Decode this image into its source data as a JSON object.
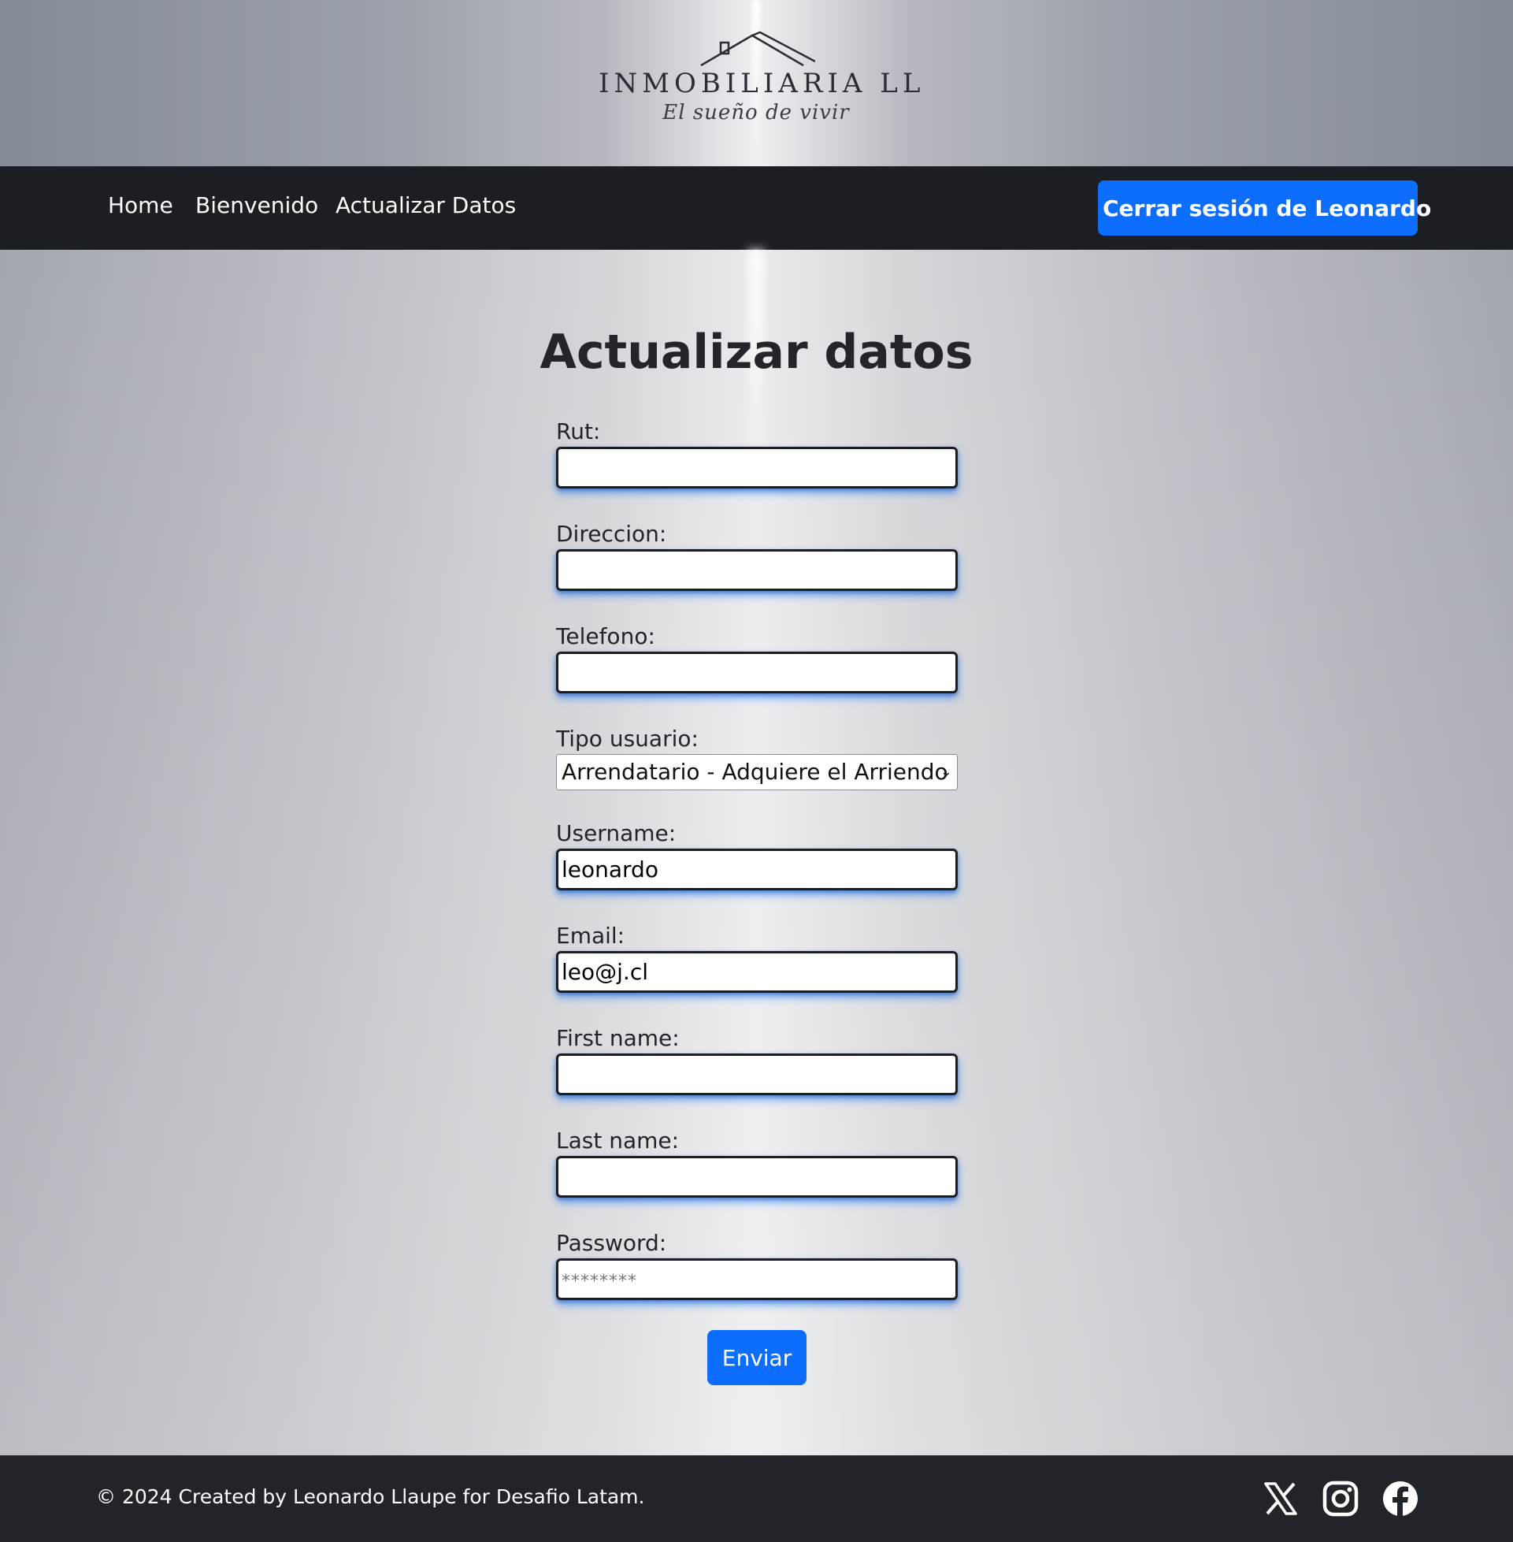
{
  "brand": {
    "name": "INMOBILIARIA LL",
    "tagline": "El sueño de vivir"
  },
  "nav": {
    "links": [
      "Home",
      "Bienvenido",
      "Actualizar Datos"
    ],
    "logout_label": "Cerrar sesión de Leonardo"
  },
  "page": {
    "title": "Actualizar datos"
  },
  "form": {
    "rut": {
      "label": "Rut:",
      "value": ""
    },
    "direccion": {
      "label": "Direccion:",
      "value": ""
    },
    "telefono": {
      "label": "Telefono:",
      "value": ""
    },
    "tipo_usuario": {
      "label": "Tipo usuario:",
      "selected": "Arrendatario - Adquiere el Arriendo"
    },
    "username": {
      "label": "Username:",
      "value": "leonardo"
    },
    "email": {
      "label": "Email:",
      "value": "leo@j.cl"
    },
    "first_name": {
      "label": "First name:",
      "value": ""
    },
    "last_name": {
      "label": "Last name:",
      "value": ""
    },
    "password": {
      "label": "Password:",
      "placeholder": "********"
    },
    "submit_label": "Enviar"
  },
  "footer": {
    "text": "© 2024 Created by Leonardo Llaupe for Desafio Latam.",
    "social_icons": [
      "x-icon",
      "instagram-icon",
      "facebook-icon"
    ]
  },
  "colors": {
    "primary": "#0d6efd",
    "navbar": "#1b1f23",
    "footer": "#212529"
  }
}
